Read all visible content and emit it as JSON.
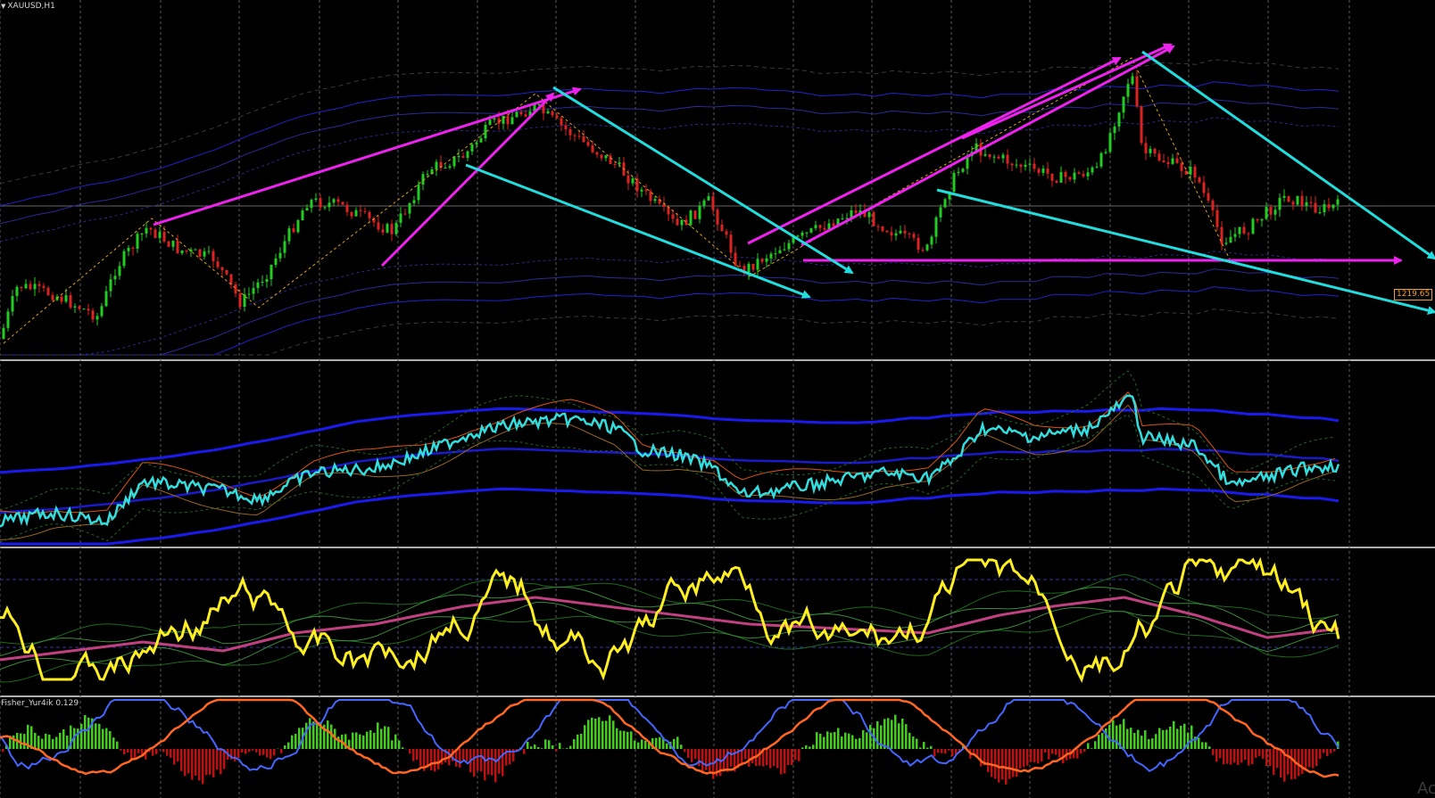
{
  "symbol_label": "XAUUSD,H1",
  "current_price": "1219.65",
  "fisher_label": "Fisher_Yur4ik 0.129",
  "watermark": "Ac",
  "colors": {
    "background": "#000000",
    "bull_candle": "#22cc22",
    "bear_candle": "#dd2222",
    "trend_magenta": "#ee22ee",
    "trend_cyan": "#22dddd",
    "band_blue": "#2222cc",
    "price_line_cyan": "#33dddd",
    "oscillator_yellow": "#ffee22",
    "fisher_green": "#44cc22",
    "fisher_red": "#bb1111",
    "fisher_orange": "#ff6622",
    "fisher_blue": "#4466ff",
    "price_tag": "#f0a030"
  }
}
